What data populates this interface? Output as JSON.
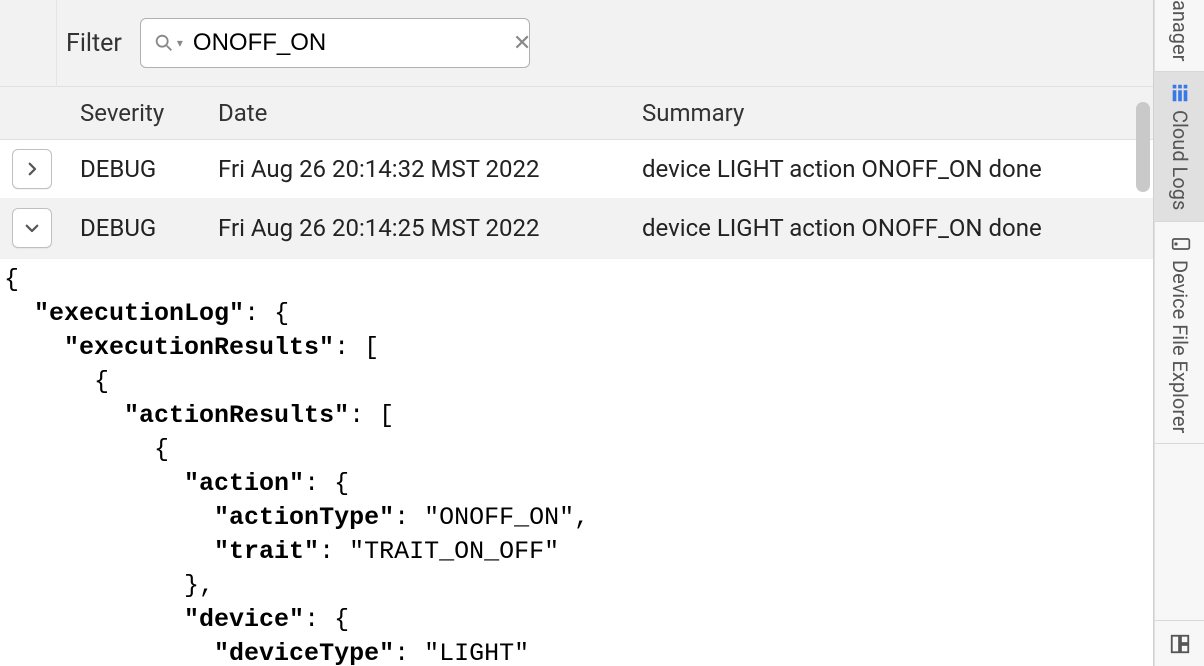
{
  "filter": {
    "label": "Filter",
    "value": "ONOFF_ON",
    "placeholder": ""
  },
  "columns": {
    "severity": "Severity",
    "date": "Date",
    "summary": "Summary"
  },
  "rows": [
    {
      "expanded": false,
      "severity": "DEBUG",
      "date": "Fri Aug 26 20:14:32 MST 2022",
      "summary": "device LIGHT action ONOFF_ON done"
    },
    {
      "expanded": true,
      "severity": "DEBUG",
      "date": "Fri Aug 26 20:14:25 MST 2022",
      "summary": "device LIGHT action ONOFF_ON done"
    }
  ],
  "detail_json": {
    "executionLog": {
      "executionResults": [
        {
          "actionResults": [
            {
              "action": {
                "actionType": "ONOFF_ON",
                "trait": "TRAIT_ON_OFF"
              },
              "device": {
                "deviceType": "LIGHT"
              }
            }
          ]
        }
      ]
    }
  },
  "detail_text": "{\n  \"executionLog\": {\n    \"executionResults\": [\n      {\n        \"actionResults\": [\n          {\n            \"action\": {\n              \"actionType\": \"ONOFF_ON\",\n              \"trait\": \"TRAIT_ON_OFF\"\n            },\n            \"device\": {\n              \"deviceType\": \"LIGHT\"",
  "sidebar": {
    "tabs": [
      {
        "id": "manager",
        "label": "anager",
        "active": false
      },
      {
        "id": "cloud-logs",
        "label": "Cloud Logs",
        "active": true
      },
      {
        "id": "device-file-explorer",
        "label": "Device File Explorer",
        "active": false
      }
    ]
  }
}
